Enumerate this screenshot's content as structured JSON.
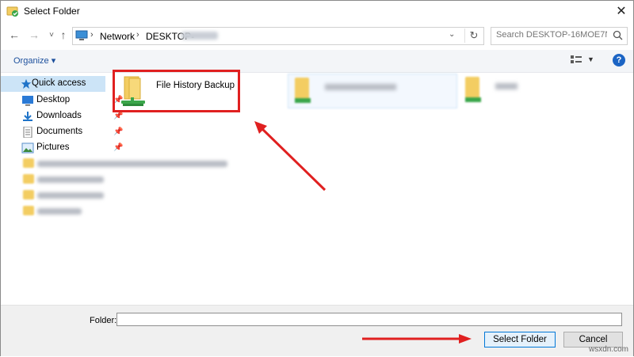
{
  "window": {
    "title": "Select Folder",
    "close_symbol": "✕"
  },
  "nav": {
    "back_symbol": "←",
    "forward_symbol": "→",
    "recent_symbol": "˅",
    "up_symbol": "↑",
    "breadcrumb": {
      "network": "Network",
      "desktop": "DESKTOP-"
    },
    "refresh_symbol": "↻",
    "search_placeholder": "Search DESKTOP-16MOE7N"
  },
  "toolbar": {
    "organize_label": "Organize ▾",
    "help_label": "?"
  },
  "sidebar": {
    "quick_access": "Quick access",
    "items": [
      {
        "label": "Desktop",
        "icon": "desktop-icon",
        "pinned": true
      },
      {
        "label": "Downloads",
        "icon": "download-icon",
        "pinned": true
      },
      {
        "label": "Documents",
        "icon": "documents-icon",
        "pinned": true
      },
      {
        "label": "Pictures",
        "icon": "pictures-icon",
        "pinned": true
      }
    ]
  },
  "content": {
    "items": [
      {
        "label": "File History Backup",
        "icon": "network-folder-icon",
        "highlighted": true
      }
    ]
  },
  "footer": {
    "folder_label": "Folder:",
    "folder_value": "",
    "select_button": "Select Folder",
    "cancel_button": "Cancel"
  },
  "watermark": "wsxdn.com",
  "colors": {
    "highlight": "#e02020",
    "accent": "#0078d7",
    "selection": "#cce4f7",
    "folder": "#f3cd62"
  }
}
